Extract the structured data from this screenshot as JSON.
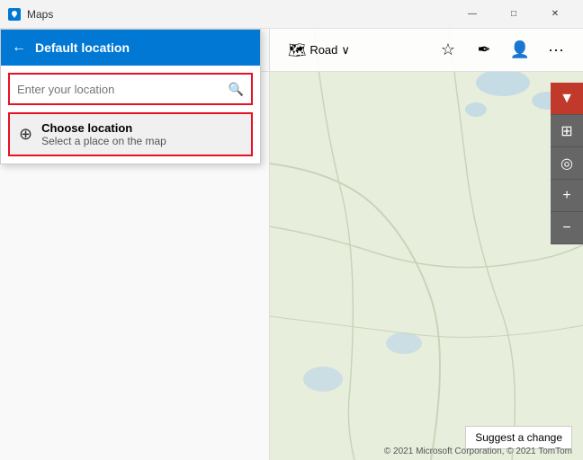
{
  "titleBar": {
    "appName": "Maps",
    "minimizeLabel": "—",
    "maximizeLabel": "□",
    "closeLabel": "✕"
  },
  "sidebarToolbar": {
    "searchIcon": "🔍",
    "favoriteIcon": "☆",
    "defaultLocationTab": "Default location",
    "tabCloseIcon": "✕"
  },
  "defaultLocationPanel": {
    "backIcon": "←",
    "title": "Default location",
    "searchPlaceholder": "Enter your location",
    "searchIcon": "🔍",
    "chooseLocationLabel": "Choose location",
    "chooseLocationSub": "Select a place on the map",
    "chooseLocationIcon": "⊕"
  },
  "mapToolbar": {
    "roadLabel": "Road",
    "roadIcon": "🗺",
    "chevron": "∨",
    "favoriteIcon": "☆",
    "penIcon": "✒",
    "profileIcon": "👤",
    "moreIcon": "···"
  },
  "mapControls": {
    "compassIcon": "▼",
    "gridIcon": "⊞",
    "locationIcon": "◎",
    "zoomInIcon": "+",
    "zoomOutIcon": "−"
  },
  "mapFooter": {
    "suggestLabel": "Suggest a change",
    "copyright": "© 2021 Microsoft Corporation, © 2021 TomTom"
  }
}
